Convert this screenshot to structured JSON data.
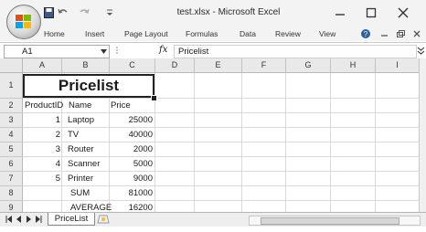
{
  "window": {
    "title": "test.xlsx - Microsoft Excel",
    "controls": {
      "minimize": "–",
      "maximize": "☐",
      "close": "✕"
    }
  },
  "ribbon": {
    "tabs": [
      "Home",
      "Insert",
      "Page Layout",
      "Formulas",
      "Data",
      "Review",
      "View"
    ]
  },
  "formula_bar": {
    "name_box": "A1",
    "fx_label": "fx",
    "content": "Pricelist"
  },
  "sheet": {
    "columns": [
      "A",
      "B",
      "C",
      "D",
      "E",
      "F",
      "G",
      "H",
      "I"
    ],
    "rows": [
      "1",
      "2",
      "3",
      "4",
      "5",
      "6",
      "7",
      "8",
      "9"
    ],
    "title": "Pricelist",
    "headers": {
      "a": "ProductID",
      "b": "Name",
      "c": "Price"
    },
    "data": [
      {
        "id": "1",
        "name": "Laptop",
        "price": "25000"
      },
      {
        "id": "2",
        "name": "TV",
        "price": "40000"
      },
      {
        "id": "3",
        "name": "Router",
        "price": "2000"
      },
      {
        "id": "4",
        "name": "Scanner",
        "price": "5000"
      },
      {
        "id": "5",
        "name": "Printer",
        "price": "9000"
      }
    ],
    "summary": [
      {
        "label": "SUM",
        "value": "81000"
      },
      {
        "label": "AVERAGE",
        "value": "16200"
      }
    ]
  },
  "sheet_tabs": {
    "active": "PriceList"
  }
}
